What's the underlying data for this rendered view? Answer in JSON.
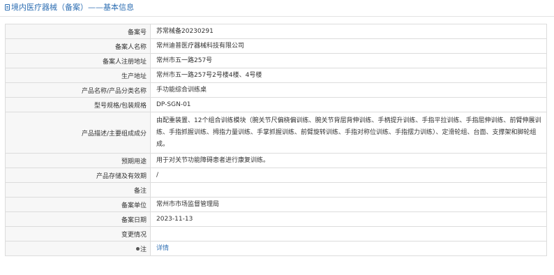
{
  "header": {
    "title": "境内医疗器械（备案）——基本信息"
  },
  "rows": [
    {
      "label": "备案号",
      "value": "苏常械备20230291"
    },
    {
      "label": "备案人名称",
      "value": "常州迪普医疗器械科技有限公司"
    },
    {
      "label": "备案人注册地址",
      "value": "常州市五一路257号"
    },
    {
      "label": "生产地址",
      "value": "常州市五一路257号2号楼4楼、4号楼"
    },
    {
      "label": "产品名称/产品分类名称",
      "value": "手功能综合训练桌"
    },
    {
      "label": "型号规格/包装规格",
      "value": "DP-SGN-01"
    },
    {
      "label": "产品描述/主要组成成分",
      "value": "由配重装置、12个组合训练模块（腕关节尺偏桡偏训练、腕关节背屈背伸训练、手柄提升训练、手指平拉训练、手指屈伸训练、前臂伸展训练、手指抓握训练、拇指力量训练、手掌抓握训练、前臂旋转训练、手指对称位训练、手指摆力训练）、定滑轮组、台面、支撑架和脚轮组成。"
    },
    {
      "label": "预期用途",
      "value": "用于对关节功能障碍患者进行康复训练。"
    },
    {
      "label": "产品存储及有效期",
      "value": "/"
    },
    {
      "label": "备注",
      "value": ""
    },
    {
      "label": "备案单位",
      "value": "常州市市场监督管理局"
    },
    {
      "label": "备案日期",
      "value": "2023-11-13"
    },
    {
      "label": "变更情况",
      "value": ""
    }
  ],
  "note_row": {
    "label": "注",
    "link": "详情",
    "icon": "bullet-icon"
  }
}
